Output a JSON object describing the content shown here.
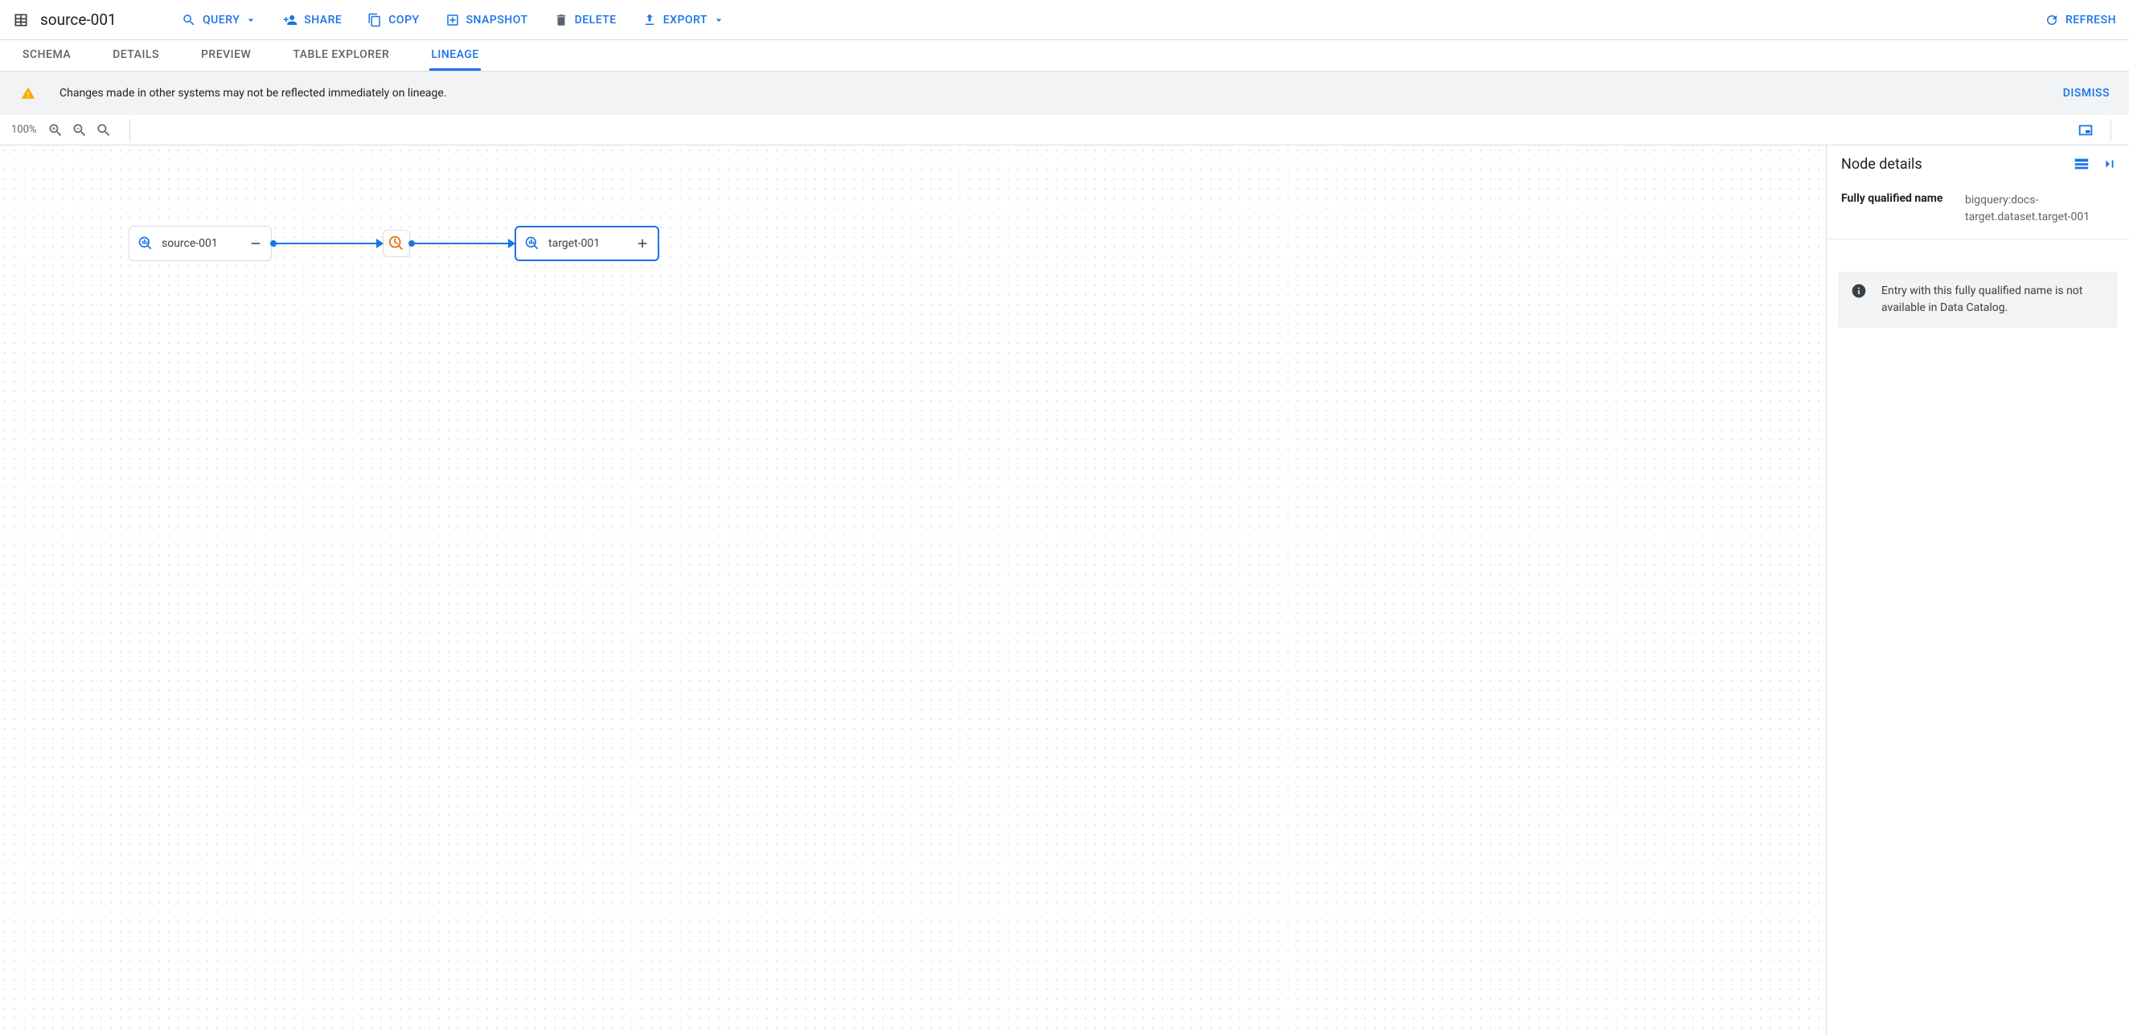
{
  "header": {
    "title": "source-001",
    "actions": {
      "query": "Query",
      "share": "Share",
      "copy": "Copy",
      "snapshot": "Snapshot",
      "delete": "Delete",
      "export": "Export",
      "refresh": "Refresh"
    }
  },
  "tabs": {
    "schema": "Schema",
    "details": "Details",
    "preview": "Preview",
    "table_explorer": "Table Explorer",
    "lineage": "Lineage",
    "active": "lineage"
  },
  "notice": {
    "message": "Changes made in other systems may not be reflected immediately on lineage.",
    "dismiss": "DISMISS"
  },
  "canvas": {
    "zoom": "100%",
    "nodes": {
      "source": {
        "label": "source-001",
        "action": "minus"
      },
      "target": {
        "label": "target-001",
        "action": "plus"
      }
    }
  },
  "side": {
    "title": "Node details",
    "fqn_label": "Fully qualified name",
    "fqn_value": "bigquery:docs-target.dataset.target-001",
    "callout": "Entry with this fully qualified name is not available in Data Catalog."
  },
  "colors": {
    "primary": "#1a73e8",
    "accent_orange": "#e8710a",
    "text": "#3c4043",
    "muted": "#5f6368",
    "surface": "#f1f3f4",
    "border": "#dadce0"
  }
}
